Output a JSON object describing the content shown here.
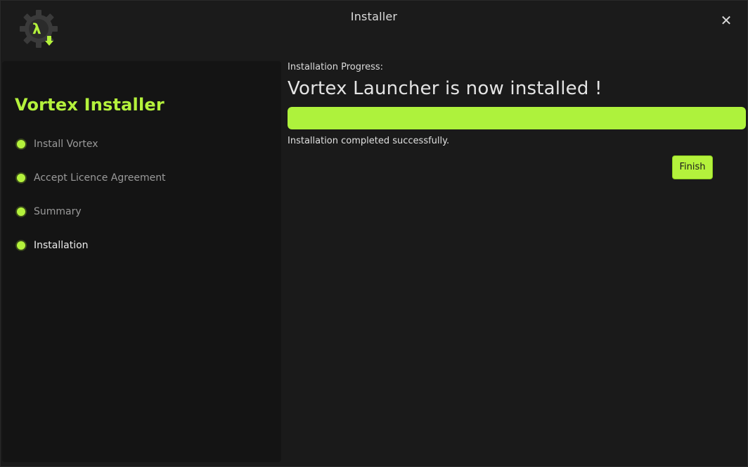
{
  "window": {
    "title": "Installer",
    "close_icon": "close-icon",
    "logo_icon": "gear-lambda-download-icon",
    "accent_color": "#b4f23c"
  },
  "sidebar": {
    "title": "Vortex Installer",
    "steps": [
      {
        "label": "Install Vortex",
        "active": false
      },
      {
        "label": "Accept Licence Agreement",
        "active": false
      },
      {
        "label": "Summary",
        "active": false
      },
      {
        "label": "Installation",
        "active": true
      }
    ]
  },
  "main": {
    "progress_caption": "Installation Progress:",
    "headline": "Vortex Launcher is now installed !",
    "progress_percent": 100,
    "status": "Installation completed successfully.",
    "finish_label": "Finish"
  }
}
